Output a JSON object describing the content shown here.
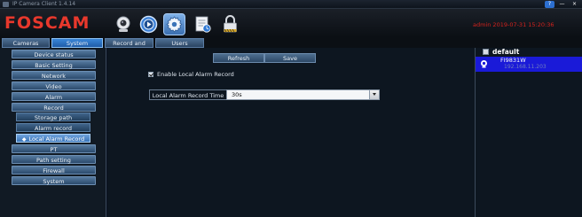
{
  "window": {
    "title": "IP Camera Client 1.4.14",
    "help": "?",
    "minimize": "—",
    "close": "×"
  },
  "header": {
    "logo": "FOSCAM",
    "status": "admin  2019-07-31  15:20:36",
    "toolbar_icons": [
      "webcam-icon",
      "playback-icon",
      "settings-icon",
      "log-icon",
      "lock-icon"
    ],
    "selected_icon": "settings-icon",
    "brand_color": "#e8382c",
    "status_color": "#d3221d"
  },
  "tabs": [
    {
      "label": "Cameras",
      "active": false
    },
    {
      "label": "System",
      "active": true
    },
    {
      "label": "Record and Alarm",
      "active": false
    },
    {
      "label": "Users",
      "active": false
    }
  ],
  "sidebar": {
    "items": [
      {
        "label": "Device status"
      },
      {
        "label": "Basic Setting"
      },
      {
        "label": "Network"
      },
      {
        "label": "Video"
      },
      {
        "label": "Alarm"
      },
      {
        "label": "Record"
      }
    ],
    "record_sub": [
      {
        "label": "Storage path"
      },
      {
        "label": "Alarm record"
      },
      {
        "label": "Local Alarm Record",
        "active": true
      }
    ],
    "items_after": [
      {
        "label": "PT"
      },
      {
        "label": "Path setting"
      },
      {
        "label": "Firewall"
      },
      {
        "label": "System"
      }
    ]
  },
  "main": {
    "refresh_label": "Refresh",
    "save_label": "Save",
    "enable_checkbox": {
      "label": "Enable Local Alarm Record",
      "checked": true
    },
    "record_time": {
      "label": "Local Alarm Record Time",
      "value": "30s"
    }
  },
  "device_tree": {
    "group": "default",
    "camera": {
      "name": "FI9831W",
      "ip": "192.168.11.203"
    }
  }
}
